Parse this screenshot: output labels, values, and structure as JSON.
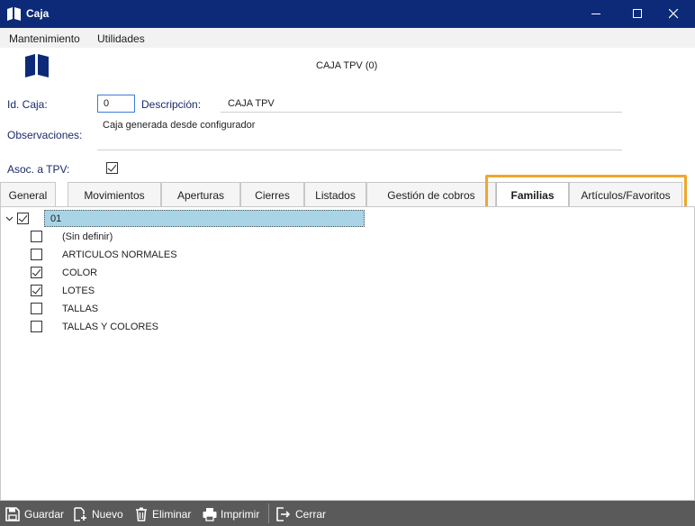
{
  "window": {
    "title": "Caja"
  },
  "menu": [
    {
      "label": "Mantenimiento"
    },
    {
      "label": "Utilidades"
    }
  ],
  "form": {
    "header": "CAJA TPV (0)",
    "id_label": "Id. Caja:",
    "id_value": "0",
    "descripcion_label": "Descripción:",
    "descripcion_value": "CAJA TPV",
    "observaciones_label": "Observaciones:",
    "observaciones_value": "Caja generada desde configurador",
    "asoc_label": "Asoc. a TPV:",
    "asoc_checked": true
  },
  "tabs": [
    {
      "label": "General",
      "active": false
    },
    {
      "label": "Movimientos",
      "active": false
    },
    {
      "label": "Aperturas",
      "active": false
    },
    {
      "label": "Cierres",
      "active": false
    },
    {
      "label": "Listados",
      "active": false
    },
    {
      "label": "Gestión de cobros",
      "active": false
    },
    {
      "label": "Familias",
      "active": true
    },
    {
      "label": "Artículos/Favoritos",
      "active": false
    }
  ],
  "tree": {
    "root": {
      "label": "01",
      "checked": true
    },
    "items": [
      {
        "label": "(Sin definir)",
        "checked": false
      },
      {
        "label": "ARTICULOS NORMALES",
        "checked": false
      },
      {
        "label": "COLOR",
        "checked": true
      },
      {
        "label": "LOTES",
        "checked": true
      },
      {
        "label": "TALLAS",
        "checked": false
      },
      {
        "label": "TALLAS Y COLORES",
        "checked": false
      }
    ]
  },
  "footer": {
    "guardar": "Guardar",
    "nuevo": "Nuevo",
    "eliminar": "Eliminar",
    "imprimir": "Imprimir",
    "cerrar": "Cerrar"
  },
  "colors": {
    "titlebar": "#0c2a78",
    "footer": "#5a5a5a",
    "highlight": "#f0a72a",
    "selection": "#a8d4e6"
  }
}
